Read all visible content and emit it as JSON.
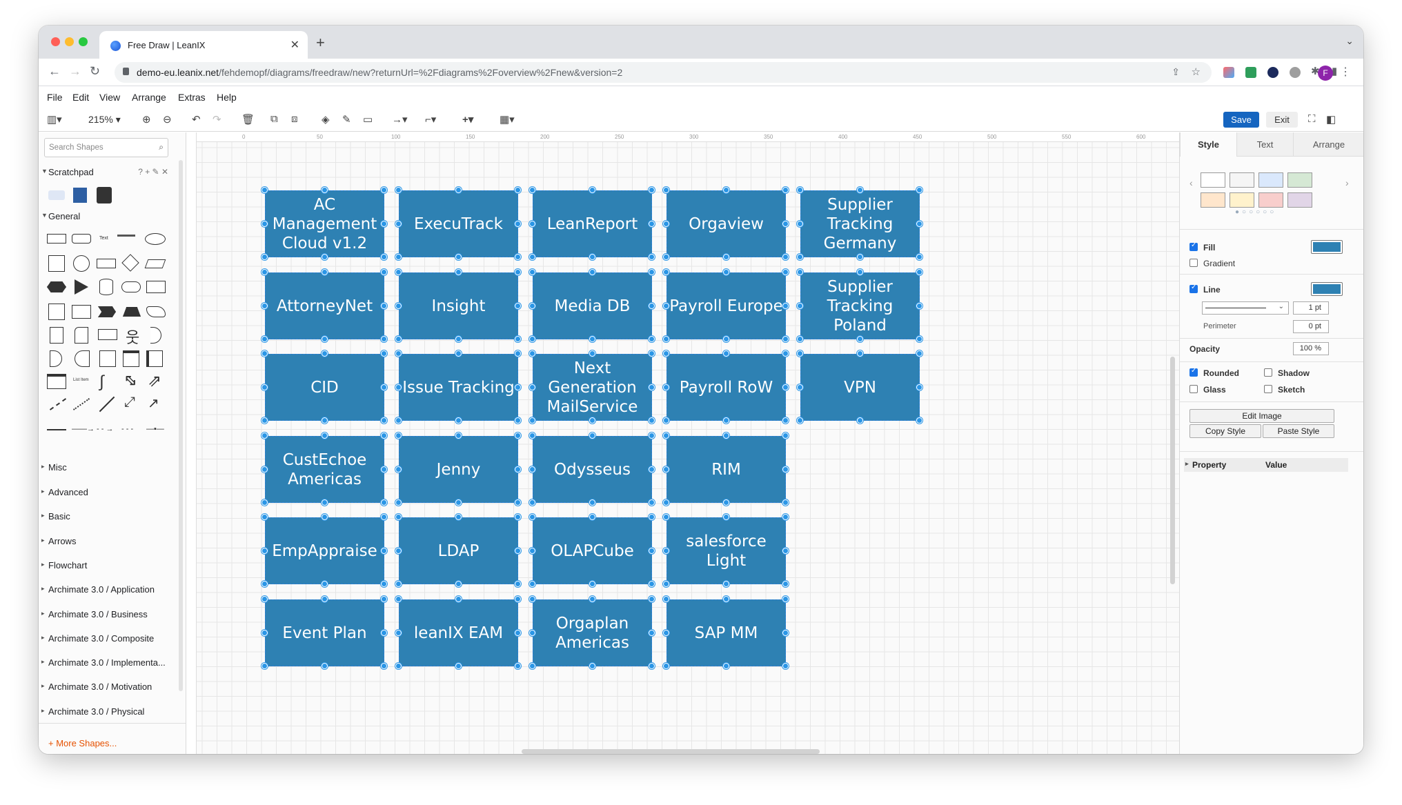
{
  "browser": {
    "tab_title": "Free Draw | LeanIX",
    "url_host": "demo-eu.leanix.net",
    "url_path": "/fehdemopf/diagrams/freedraw/new?returnUrl=%2Fdiagrams%2Foverview%2Fnew&version=2",
    "profile_initial": "F"
  },
  "menu": [
    "File",
    "Edit",
    "View",
    "Arrange",
    "Extras",
    "Help"
  ],
  "toolbar": {
    "zoom": "215%",
    "save_label": "Save",
    "exit_label": "Exit"
  },
  "sidebar": {
    "search_placeholder": "Search Shapes",
    "scratchpad": "Scratchpad",
    "general": "General",
    "sections": [
      "Misc",
      "Advanced",
      "Basic",
      "Arrows",
      "Flowchart",
      "Archimate 3.0 / Application",
      "Archimate 3.0 / Business",
      "Archimate 3.0 / Composite",
      "Archimate 3.0 / Implementa...",
      "Archimate 3.0 / Motivation",
      "Archimate 3.0 / Physical"
    ],
    "more_shapes": "+ More Shapes..."
  },
  "ruler_ticks": [
    "0",
    "50",
    "100",
    "150",
    "200",
    "250",
    "300",
    "350",
    "400",
    "450",
    "500",
    "550",
    "600"
  ],
  "nodes": [
    [
      "AC Management Cloud v1.2",
      "ExecuTrack",
      "LeanReport",
      "Orgaview",
      "Supplier Tracking Germany"
    ],
    [
      "AttorneyNet",
      "Insight",
      "Media DB",
      "Payroll Europe",
      "Supplier Tracking Poland"
    ],
    [
      "CID",
      "Issue Tracking",
      "Next Generation MailService",
      "Payroll RoW",
      "VPN"
    ],
    [
      "CustEchoe Americas",
      "Jenny",
      "Odysseus",
      "RIM"
    ],
    [
      "EmpAppraise",
      "LDAP",
      "OLAPCube",
      "salesforce Light"
    ],
    [
      "Event Plan",
      "leanIX EAM",
      "Orgaplan Americas",
      "SAP MM"
    ]
  ],
  "node_color": "#2e81b3",
  "format_panel": {
    "tabs": [
      "Style",
      "Text",
      "Arrange"
    ],
    "fill": "Fill",
    "gradient": "Gradient",
    "line": "Line",
    "line_width": "1 pt",
    "perimeter": "Perimeter",
    "perimeter_value": "0 pt",
    "opacity": "Opacity",
    "opacity_value": "100 %",
    "rounded": "Rounded",
    "shadow": "Shadow",
    "glass": "Glass",
    "sketch": "Sketch",
    "edit_image": "Edit Image",
    "copy_style": "Copy Style",
    "paste_style": "Paste Style",
    "property": "Property",
    "value": "Value",
    "swatches": [
      "#ffffff",
      "#f5f5f5",
      "#dae8fc",
      "#d5e8d4",
      "#ffe6cc",
      "#fff2cc",
      "#f8cecc",
      "#e1d5e7"
    ]
  }
}
